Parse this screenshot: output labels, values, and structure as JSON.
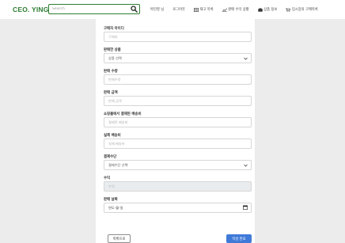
{
  "navbar": {
    "brand": "CEO. YING",
    "search": {
      "placeholder": "Search"
    },
    "items": [
      {
        "label": "박민영 님"
      },
      {
        "label": "로그아웃"
      },
      {
        "label": "재고 목록"
      },
      {
        "label": "판매 수익 상황"
      },
      {
        "label": "상품 정보"
      },
      {
        "label": "임시장의 구매목록"
      }
    ]
  },
  "form": {
    "buyer_id": {
      "label": "구매자 아이디",
      "placeholder": "구매자"
    },
    "product": {
      "label": "판매한 상품",
      "value": "상품 선택"
    },
    "quantity": {
      "label": "판매 수량",
      "placeholder": "판매수량"
    },
    "amount": {
      "label": "판매 금액",
      "placeholder": "판매 금액"
    },
    "mall_fee": {
      "label": "쇼핑몰에서 결제된 배송비",
      "placeholder": "결제된 배송비"
    },
    "actual_shipping": {
      "label": "실제 배송비",
      "placeholder": "실제 배송비"
    },
    "payment": {
      "label": "결제수단",
      "value": "결제수단 선택"
    },
    "profit": {
      "label": "수익",
      "placeholder": "수익"
    },
    "sale_date": {
      "label": "판매 날짜",
      "value": "연도-월-일"
    }
  },
  "buttons": {
    "back": "목록으로",
    "submit": "작성 완료"
  },
  "colors": {
    "brand": "#2e7d32",
    "primary": "#3f7ad9",
    "background": "#ececec"
  }
}
